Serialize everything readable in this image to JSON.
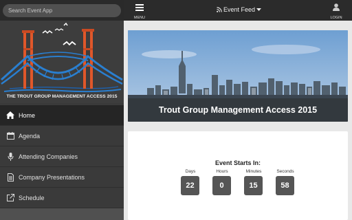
{
  "search": {
    "placeholder": "Search Event App"
  },
  "banner": {
    "title": "THE TROUT GROUP MANAGEMENT ACCESS 2015"
  },
  "sidebar": {
    "items": [
      {
        "label": "Home",
        "icon": "home-icon",
        "active": true
      },
      {
        "label": "Agenda",
        "icon": "calendar-icon",
        "active": false
      },
      {
        "label": "Attending Companies",
        "icon": "microphone-icon",
        "active": false
      },
      {
        "label": "Company Presentations",
        "icon": "document-icon",
        "active": false
      },
      {
        "label": "Schedule",
        "icon": "external-link-icon",
        "active": false
      }
    ]
  },
  "topbar": {
    "menu_label": "MENU",
    "feed_label": "Event Feed",
    "login_label": "LOGIN"
  },
  "hero": {
    "title": "Trout Group Management Access 2015"
  },
  "countdown": {
    "title": "Event Starts In:",
    "units": [
      {
        "label": "Days",
        "value": "22"
      },
      {
        "label": "Hours",
        "value": "0"
      },
      {
        "label": "Minutes",
        "value": "15"
      },
      {
        "label": "Seconds",
        "value": "58"
      }
    ]
  },
  "colors": {
    "sidebar_bg": "#3a3a3a",
    "topbar_bg": "#2b2b2b",
    "bridge_orange": "#e0572a",
    "bridge_blue": "#2a7fd0",
    "count_box": "#555555"
  }
}
